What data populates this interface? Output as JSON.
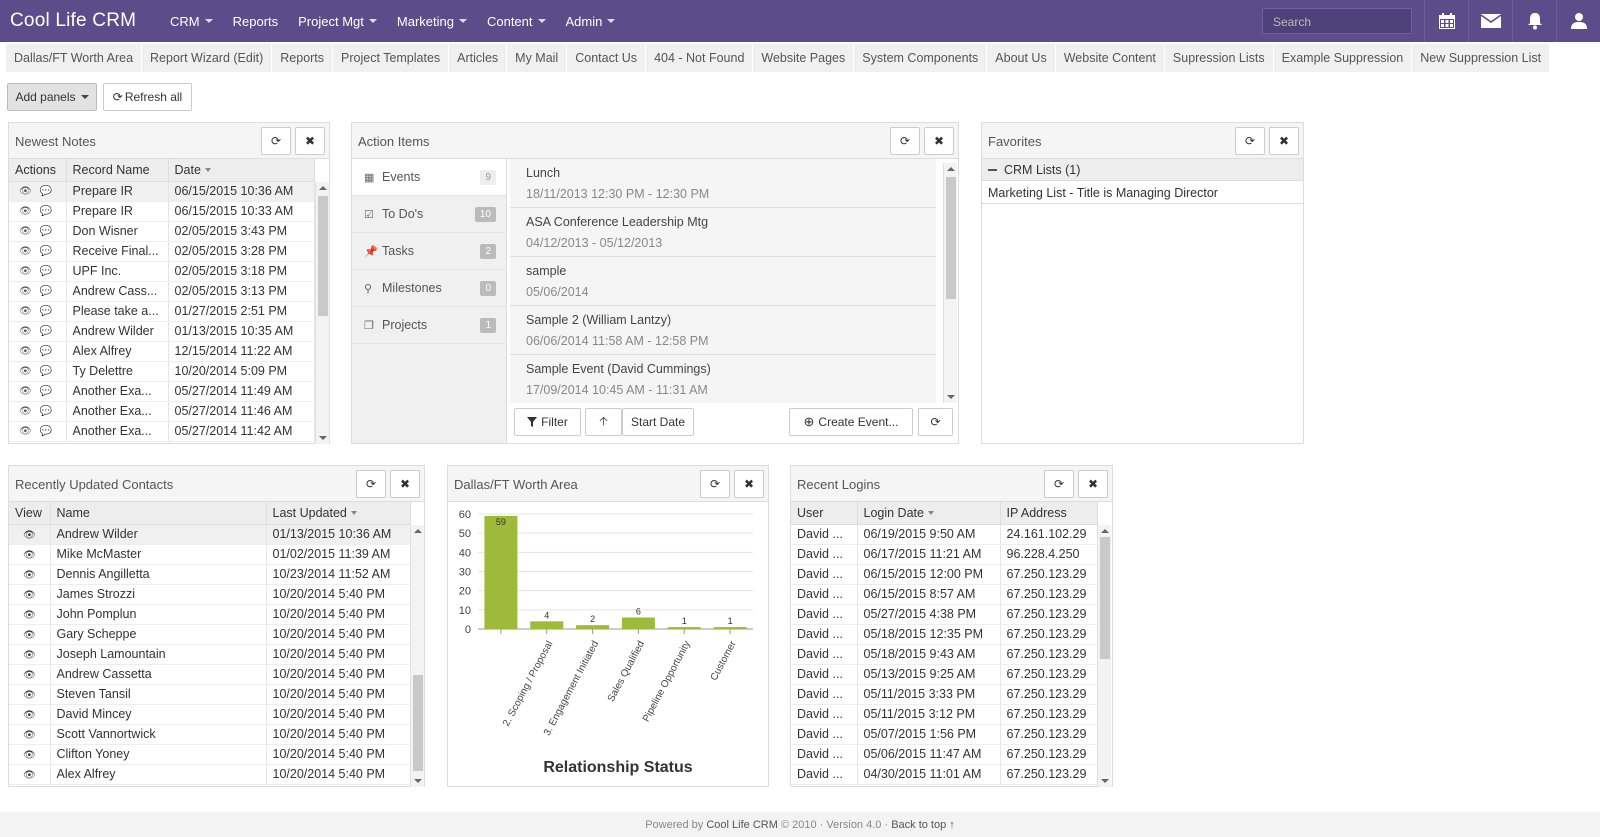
{
  "nav": {
    "brand": "Cool Life CRM",
    "items": [
      {
        "label": "CRM",
        "caret": true
      },
      {
        "label": "Reports",
        "caret": false
      },
      {
        "label": "Project Mgt",
        "caret": true
      },
      {
        "label": "Marketing",
        "caret": true
      },
      {
        "label": "Content",
        "caret": true
      },
      {
        "label": "Admin",
        "caret": true
      }
    ],
    "search_placeholder": "Search",
    "icons": [
      "calendar-icon",
      "mail-icon",
      "bell-icon",
      "user-icon"
    ]
  },
  "tabs": [
    "Dallas/FT Worth Area",
    "Report Wizard (Edit)",
    "Reports",
    "Project Templates",
    "Articles",
    "My Mail",
    "Contact Us",
    "404 - Not Found",
    "Website Pages",
    "System Components",
    "About Us",
    "Website Content",
    "Supression Lists",
    "Example Suppression",
    "New Suppression List"
  ],
  "toolbar": {
    "add_panels": "Add panels",
    "refresh_all": "Refresh all"
  },
  "newest_notes": {
    "title": "Newest Notes",
    "columns": [
      "Actions",
      "Record Name",
      "Date"
    ],
    "rows": [
      [
        "Prepare IR",
        "06/15/2015 10:36 AM"
      ],
      [
        "Prepare IR",
        "06/15/2015 10:33 AM"
      ],
      [
        "Don Wisner",
        "02/05/2015 3:43 PM"
      ],
      [
        "Receive Final...",
        "02/05/2015 3:28 PM"
      ],
      [
        "UPF Inc.",
        "02/05/2015 3:18 PM"
      ],
      [
        "Andrew Cass...",
        "02/05/2015 3:13 PM"
      ],
      [
        "Please take a...",
        "01/27/2015 2:51 PM"
      ],
      [
        "Andrew Wilder",
        "01/13/2015 10:35 AM"
      ],
      [
        "Alex Alfrey",
        "12/15/2014 11:22 AM"
      ],
      [
        "Ty Delettre",
        "10/20/2014 5:09 PM"
      ],
      [
        "Another Exa...",
        "05/27/2014 11:49 AM"
      ],
      [
        "Another Exa...",
        "05/27/2014 11:46 AM"
      ],
      [
        "Another Exa...",
        "05/27/2014 11:42 AM"
      ]
    ]
  },
  "action_items": {
    "title": "Action Items",
    "categories": [
      {
        "label": "Events",
        "count": "9",
        "icon": "calendar-icon"
      },
      {
        "label": "To Do's",
        "count": "10",
        "icon": "checkbox-icon"
      },
      {
        "label": "Tasks",
        "count": "2",
        "icon": "pin-icon"
      },
      {
        "label": "Milestones",
        "count": "0",
        "icon": "map-marker-icon"
      },
      {
        "label": "Projects",
        "count": "1",
        "icon": "files-icon"
      }
    ],
    "events": [
      {
        "title": "Lunch",
        "date": "18/11/2013 12:30 PM - 12:30 PM"
      },
      {
        "title": "ASA Conference Leadership Mtg",
        "date": "04/12/2013 - 05/12/2013"
      },
      {
        "title": "sample",
        "date": "05/06/2014"
      },
      {
        "title": "Sample 2 (William Lantzy)",
        "date": "06/06/2014 11:58 AM - 12:58 PM"
      },
      {
        "title": "Sample Event (David Cummings)",
        "date": "17/09/2014 10:45 AM - 11:31 AM"
      }
    ],
    "filter": "Filter",
    "start_date": "Start Date",
    "create_event": "Create Event..."
  },
  "favorites": {
    "title": "Favorites",
    "group": "CRM Lists (1)",
    "items": [
      "Marketing List - Title is Managing Director"
    ]
  },
  "contacts": {
    "title": "Recently Updated Contacts",
    "columns": [
      "View",
      "Name",
      "Last Updated"
    ],
    "rows": [
      [
        "Andrew Wilder",
        "01/13/2015 10:36 AM"
      ],
      [
        "Mike McMaster",
        "01/02/2015 11:39 AM"
      ],
      [
        "Dennis Angilletta",
        "10/23/2014 11:52 AM"
      ],
      [
        "James Strozzi",
        "10/20/2014 5:40 PM"
      ],
      [
        "John Pomplun",
        "10/20/2014 5:40 PM"
      ],
      [
        "Gary Scheppe",
        "10/20/2014 5:40 PM"
      ],
      [
        "Joseph Lamountain",
        "10/20/2014 5:40 PM"
      ],
      [
        "Andrew Cassetta",
        "10/20/2014 5:40 PM"
      ],
      [
        "Steven Tansil",
        "10/20/2014 5:40 PM"
      ],
      [
        "David Mincey",
        "10/20/2014 5:40 PM"
      ],
      [
        "Scott Vannortwick",
        "10/20/2014 5:40 PM"
      ],
      [
        "Clifton Yoney",
        "10/20/2014 5:40 PM"
      ],
      [
        "Alex Alfrey",
        "10/20/2014 5:40 PM"
      ]
    ]
  },
  "chart_panel": {
    "title": "Dallas/FT Worth Area"
  },
  "chart_data": {
    "type": "bar",
    "title": "Relationship Status",
    "categories": [
      "",
      "2. Scoping / Proposal",
      "3. Engagement Initiated",
      "Sales Qualified",
      "Pipeline Opportunity",
      "Customer"
    ],
    "values": [
      59,
      4,
      2,
      6,
      1,
      1
    ],
    "ylim": [
      0,
      60
    ],
    "yticks": [
      0,
      10,
      20,
      30,
      40,
      50,
      60
    ],
    "color": "#9fb93a"
  },
  "logins": {
    "title": "Recent Logins",
    "columns": [
      "User",
      "Login Date",
      "IP Address"
    ],
    "rows": [
      [
        "David ...",
        "06/19/2015 9:50 AM",
        "24.161.102.29"
      ],
      [
        "David ...",
        "06/17/2015 11:21 AM",
        "96.228.4.250"
      ],
      [
        "David ...",
        "06/15/2015 12:00 PM",
        "67.250.123.29"
      ],
      [
        "David ...",
        "06/15/2015 8:57 AM",
        "67.250.123.29"
      ],
      [
        "David ...",
        "05/27/2015 4:38 PM",
        "67.250.123.29"
      ],
      [
        "David ...",
        "05/18/2015 12:35 PM",
        "67.250.123.29"
      ],
      [
        "David ...",
        "05/18/2015 9:43 AM",
        "67.250.123.29"
      ],
      [
        "David ...",
        "05/13/2015 9:25 AM",
        "67.250.123.29"
      ],
      [
        "David ...",
        "05/11/2015 3:33 PM",
        "67.250.123.29"
      ],
      [
        "David ...",
        "05/11/2015 3:12 PM",
        "67.250.123.29"
      ],
      [
        "David ...",
        "05/07/2015 1:56 PM",
        "67.250.123.29"
      ],
      [
        "David ...",
        "05/06/2015 11:47 AM",
        "67.250.123.29"
      ],
      [
        "David ...",
        "04/30/2015 11:01 AM",
        "67.250.123.29"
      ]
    ]
  },
  "footer": {
    "powered": "Powered by",
    "brand": "Cool Life CRM",
    "copy": "© 2010 · Version 4.0 ·",
    "back": "Back to top ↑"
  }
}
